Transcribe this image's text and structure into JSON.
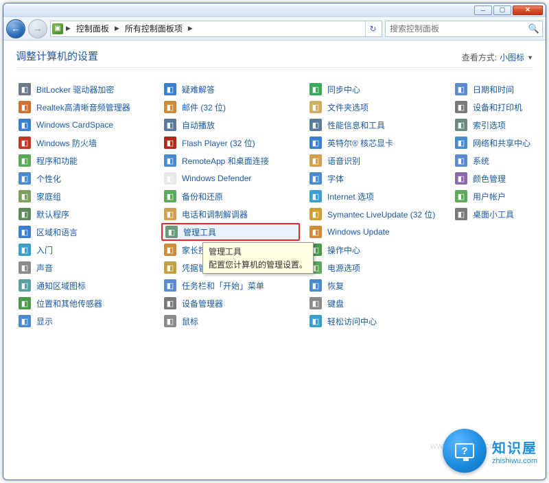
{
  "breadcrumb": {
    "seg1": "控制面板",
    "seg2": "所有控制面板项"
  },
  "search": {
    "placeholder": "搜索控制面板"
  },
  "header": {
    "title": "调整计算机的设置",
    "view_label": "查看方式:",
    "view_value": "小图标"
  },
  "tooltip": {
    "title": "管理工具",
    "desc": "配置您计算机的管理设置。"
  },
  "items": [
    {
      "label": "BitLocker 驱动器加密",
      "icon": "lock",
      "bg": "#6a7a8a"
    },
    {
      "label": "Realtek高清晰音频管理器",
      "icon": "spk",
      "bg": "#d07030"
    },
    {
      "label": "Windows CardSpace",
      "icon": "card",
      "bg": "#3a7fcf"
    },
    {
      "label": "Windows 防火墙",
      "icon": "wall",
      "bg": "#c03a2a"
    },
    {
      "label": "程序和功能",
      "icon": "prog",
      "bg": "#5aa85a"
    },
    {
      "label": "个性化",
      "icon": "pers",
      "bg": "#4a8acf"
    },
    {
      "label": "家庭组",
      "icon": "home",
      "bg": "#7aa05a"
    },
    {
      "label": "默认程序",
      "icon": "def",
      "bg": "#5a8a5a"
    },
    {
      "label": "区域和语言",
      "icon": "reg",
      "bg": "#3a7fcf"
    },
    {
      "label": "入门",
      "icon": "start",
      "bg": "#3a9fcf"
    },
    {
      "label": "声音",
      "icon": "snd",
      "bg": "#8a8a8a"
    },
    {
      "label": "通知区域图标",
      "icon": "tray",
      "bg": "#5aa0a0"
    },
    {
      "label": "位置和其他传感器",
      "icon": "loc",
      "bg": "#4a9a4a"
    },
    {
      "label": "显示",
      "icon": "disp",
      "bg": "#4a8acf"
    },
    {
      "label": "疑难解答",
      "icon": "trbl",
      "bg": "#3a7fcf"
    },
    {
      "label": "邮件 (32 位)",
      "icon": "mail",
      "bg": "#d08a3a"
    },
    {
      "label": "自动播放",
      "icon": "auto",
      "bg": "#5a7a9a"
    },
    {
      "label": "Flash Player (32 位)",
      "icon": "flash",
      "bg": "#b02a1a"
    },
    {
      "label": "RemoteApp 和桌面连接",
      "icon": "remote",
      "bg": "#4a8acf"
    },
    {
      "label": "Windows Defender",
      "icon": "def2",
      "bg": "#e8e8e8"
    },
    {
      "label": "备份和还原",
      "icon": "bak",
      "bg": "#5aa85a"
    },
    {
      "label": "电话和调制解调器",
      "icon": "phone",
      "bg": "#d0a050"
    },
    {
      "label": "管理工具",
      "icon": "admin",
      "bg": "#6a9a7a",
      "hi": true
    },
    {
      "label": "家长控制",
      "icon": "parent",
      "bg": "#d08a3a"
    },
    {
      "label": "凭据管理器",
      "icon": "cred",
      "bg": "#c0a040"
    },
    {
      "label": "任务栏和「开始」菜单",
      "icon": "task",
      "bg": "#5a8acf"
    },
    {
      "label": "设备管理器",
      "icon": "devmgr",
      "bg": "#7a7a7a"
    },
    {
      "label": "鼠标",
      "icon": "mouse",
      "bg": "#8a8a8a"
    },
    {
      "label": "同步中心",
      "icon": "sync",
      "bg": "#3aa85a"
    },
    {
      "label": "文件夹选项",
      "icon": "folder",
      "bg": "#d0b060"
    },
    {
      "label": "性能信息和工具",
      "icon": "perf",
      "bg": "#5a7a9a"
    },
    {
      "label": "英特尔® 核芯显卡",
      "icon": "intel",
      "bg": "#3a7fcf"
    },
    {
      "label": "语音识别",
      "icon": "speech",
      "bg": "#d0a050"
    },
    {
      "label": "字体",
      "icon": "font",
      "bg": "#4a8acf"
    },
    {
      "label": "Internet 选项",
      "icon": "ie",
      "bg": "#3a9fcf"
    },
    {
      "label": "Symantec LiveUpdate (32 位)",
      "icon": "sym",
      "bg": "#d0a030"
    },
    {
      "label": "Windows Update",
      "icon": "wu",
      "bg": "#d08a3a"
    },
    {
      "label": "操作中心",
      "icon": "action",
      "bg": "#4a9a4a"
    },
    {
      "label": "电源选项",
      "icon": "power",
      "bg": "#5aa85a"
    },
    {
      "label": "恢复",
      "icon": "recov",
      "bg": "#4a8acf"
    },
    {
      "label": "键盘",
      "icon": "kb",
      "bg": "#8a8a8a"
    },
    {
      "label": "轻松访问中心",
      "icon": "ease",
      "bg": "#3a9fcf"
    },
    {
      "label": "日期和时间",
      "icon": "date",
      "bg": "#5a8acf"
    },
    {
      "label": "设备和打印机",
      "icon": "devprn",
      "bg": "#7a7a7a"
    },
    {
      "label": "索引选项",
      "icon": "index",
      "bg": "#6a8a7a"
    },
    {
      "label": "网络和共享中心",
      "icon": "net",
      "bg": "#4a8acf"
    },
    {
      "label": "系统",
      "icon": "sys",
      "bg": "#5a8acf"
    },
    {
      "label": "颜色管理",
      "icon": "color",
      "bg": "#8a6aaa"
    },
    {
      "label": "用户帐户",
      "icon": "user",
      "bg": "#5aa85a"
    },
    {
      "label": "桌面小工具",
      "icon": "gadget",
      "bg": "#7a7a7a"
    }
  ],
  "watermark": {
    "big": "知识屋",
    "url": "zhishiwu.com",
    "ghost": "www.dnjjshm.com"
  }
}
